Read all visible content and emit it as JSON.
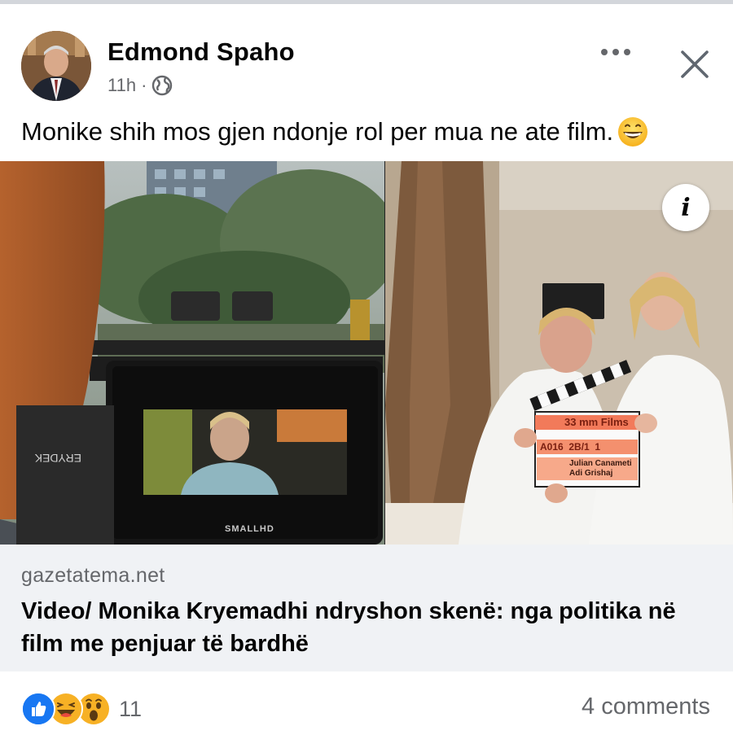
{
  "post": {
    "author": "Edmond Spaho",
    "time": "11h",
    "separator": "·",
    "text": "Monike shih mos gjen ndonje rol per mua ne ate film.",
    "icons": {
      "more": "more-options-icon",
      "close": "close-icon",
      "audience": "globe-icon",
      "emoji": "grinning-face-icon",
      "info": "info-icon"
    }
  },
  "photo": {
    "info_label": "i",
    "monitor_brand": "SMALLHD",
    "clapper_title": "33 mm Films",
    "clapper_scene": "A016  2B/1  1",
    "clapper_director": "Julian Canameti",
    "clapper_camera": "Adi Grishaj"
  },
  "link": {
    "domain": "gazetatema.net",
    "title": "Video/ Monika Kryemadhi ndryshon skenë: nga politika në film me penjuar të bardhë"
  },
  "footer": {
    "reaction_count": "11",
    "comments": "4 comments",
    "reaction_icons": [
      "like-icon",
      "haha-icon",
      "wow-icon"
    ]
  },
  "colors": {
    "like_blue": "#1877f2",
    "reaction_yellow": "#f7b125",
    "secondary_text": "#65676b",
    "link_bg": "#f0f2f5"
  }
}
